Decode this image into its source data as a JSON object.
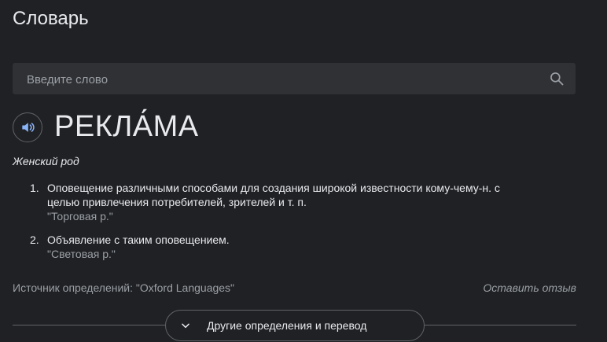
{
  "header": {
    "title": "Словарь"
  },
  "search": {
    "placeholder": "Введите слово"
  },
  "entry": {
    "word": "РЕКЛА́МА",
    "part_of_speech": "Женский род",
    "definitions": [
      {
        "number": "1.",
        "line1": "Оповещение различными способами для создания широкой известности кому-чему-н. с",
        "line2": "целью привлечения потребителей, зрителей и т. п.",
        "example": "\"Торговая р.\""
      },
      {
        "number": "2.",
        "line1": "Объявление с таким оповещением.",
        "example": "\"Световая р.\""
      }
    ]
  },
  "footer": {
    "source": "Источник определений: \"Oxford Languages\"",
    "feedback": "Оставить отзыв",
    "more_button": "Другие определения и перевод"
  },
  "icons": {
    "search": "search-icon",
    "speaker": "speaker-icon",
    "expand": "chevron-down-icon"
  },
  "colors": {
    "background": "#202124",
    "search_bg": "#303134",
    "text": "#e8eaed",
    "muted": "#9aa0a6",
    "accent": "#8ab4f8"
  }
}
